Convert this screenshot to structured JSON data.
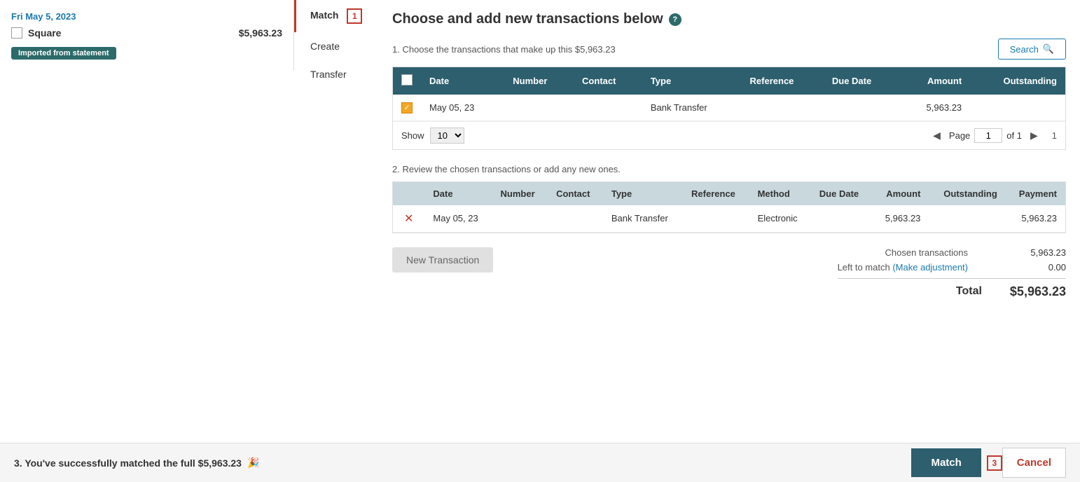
{
  "left_panel": {
    "date": "Fri May 5, 2023",
    "name": "Square",
    "amount": "$5,963.23",
    "badge": "Imported from statement"
  },
  "tabs": {
    "match": "Match",
    "create": "Create",
    "transfer": "Transfer",
    "match_step": "1"
  },
  "main": {
    "title": "Choose and add new transactions below",
    "section1_label": "1. Choose the transactions that make up this $5,963.23",
    "search_label": "Search",
    "table1": {
      "headers": [
        "",
        "Date",
        "Number",
        "Contact",
        "Type",
        "Reference",
        "Due Date",
        "Amount",
        "Outstanding"
      ],
      "rows": [
        {
          "date": "May 05, 23",
          "number": "",
          "contact": "",
          "type": "Bank Transfer",
          "reference": "",
          "due_date": "",
          "amount": "5,963.23",
          "outstanding": ""
        }
      ]
    },
    "show_label": "Show",
    "show_value": "10",
    "page_label": "Page",
    "page_value": "1",
    "of_label": "of 1",
    "row_count": "1",
    "section2_label": "2. Review the chosen transactions or add any new ones.",
    "table2": {
      "headers": [
        "",
        "Date",
        "Number",
        "Contact",
        "Type",
        "Reference",
        "Method",
        "Due Date",
        "Amount",
        "Outstanding",
        "Payment"
      ],
      "rows": [
        {
          "date": "May 05, 23",
          "number": "",
          "contact": "",
          "type": "Bank Transfer",
          "reference": "",
          "method": "Electronic",
          "due_date": "",
          "amount": "5,963.23",
          "outstanding": "",
          "payment": "5,963.23"
        }
      ]
    },
    "new_transaction_label": "New Transaction",
    "chosen_label": "Chosen transactions",
    "chosen_value": "5,963.23",
    "left_label": "Left to match",
    "make_adj_label": "(Make adjustment)",
    "left_value": "0.00",
    "total_label": "Total",
    "total_value": "$5,963.23"
  },
  "footer": {
    "success_text": "3. You've successfully matched the full $5,963.23",
    "party_emoji": "🎉",
    "match_btn": "Match",
    "cancel_btn": "Cancel",
    "step3": "3"
  }
}
